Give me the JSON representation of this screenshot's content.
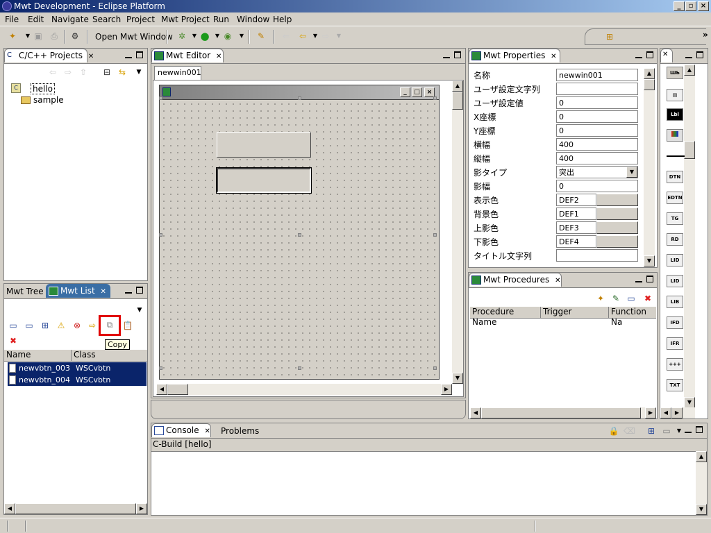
{
  "window": {
    "title": "Mwt Development - Eclipse Platform"
  },
  "menu": [
    "File",
    "Edit",
    "Navigate",
    "Search",
    "Project",
    "Mwt Project",
    "Run",
    "Window",
    "Help"
  ],
  "toolbar": {
    "open_mwt_window": "Open Mwt Window"
  },
  "projects": {
    "tab": "C/C++ Projects",
    "items": [
      "hello",
      "sample"
    ]
  },
  "mwt_list": {
    "tabs": [
      "Mwt Tree",
      "Mwt List"
    ],
    "columns": [
      "Name",
      "Class"
    ],
    "rows": [
      {
        "name": "newvbtn_003",
        "class": "WSCvbtn"
      },
      {
        "name": "newvbtn_004",
        "class": "WSCvbtn"
      }
    ],
    "tooltip": "Copy"
  },
  "editor": {
    "tab": "Mwt Editor",
    "subtab": "newwin001"
  },
  "properties": {
    "tab": "Mwt Properties",
    "rows": [
      {
        "label": "名称",
        "value": "newwin001"
      },
      {
        "label": "ユーザ設定文字列",
        "value": ""
      },
      {
        "label": "ユーザ設定値",
        "value": "0"
      },
      {
        "label": "X座標",
        "value": "0"
      },
      {
        "label": "Y座標",
        "value": "0"
      },
      {
        "label": "横幅",
        "value": "400"
      },
      {
        "label": "縦幅",
        "value": "400"
      },
      {
        "label": "影タイプ",
        "value": "突出"
      },
      {
        "label": "影幅",
        "value": "0"
      },
      {
        "label": "表示色",
        "value": "DEF2"
      },
      {
        "label": "背景色",
        "value": "DEF1"
      },
      {
        "label": "上影色",
        "value": "DEF3"
      },
      {
        "label": "下影色",
        "value": "DEF4"
      },
      {
        "label": "タイトル文字列",
        "value": ""
      }
    ]
  },
  "procedures": {
    "tab": "Mwt Procedures",
    "columns": [
      "Procedure Name",
      "Trigger",
      "Function Na"
    ]
  },
  "palette": [
    "DTN",
    "EDTN",
    "TG",
    "RD",
    "LID",
    "LID",
    "LIB",
    "IFD",
    "IFR",
    "+++",
    "TXT"
  ],
  "console": {
    "tabs": [
      "Console",
      "Problems"
    ],
    "label": "C-Build [hello]"
  }
}
